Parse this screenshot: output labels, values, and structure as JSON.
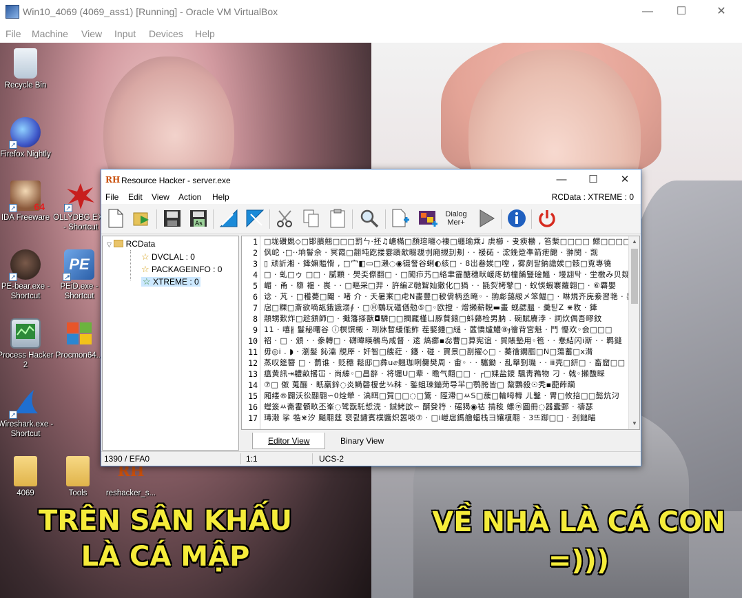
{
  "vbox": {
    "title": "Win10_4069 (4069_ass1) [Running] - Oracle VM VirtualBox",
    "menu": [
      "File",
      "Machine",
      "View",
      "Input",
      "Devices",
      "Help"
    ],
    "controls": {
      "minimize": "—",
      "maximize": "☐",
      "close": "✕"
    }
  },
  "desktop": {
    "icons": [
      {
        "label": "Recycle Bin",
        "icon": "recycle-bin-icon",
        "color": "#d9e6f2"
      },
      {
        "label": "Firefox Nightly",
        "icon": "firefox-nightly-icon",
        "color": "#3f57c8"
      },
      {
        "label": "IDA Freeware",
        "icon": "ida-icon",
        "color": "#8b5a3c",
        "badge": "64"
      },
      {
        "label": "OLLYDBG.EXE - Shortcut",
        "icon": "ollydbg-icon",
        "color": "#c81e1e"
      },
      {
        "label": "PE-bear.exe - Shortcut",
        "icon": "pe-bear-icon",
        "color": "#3b2b24"
      },
      {
        "label": "PEiD.exe - Shortcut",
        "icon": "peid-icon",
        "color": "#2b5fa8",
        "badge": "PE"
      },
      {
        "label": "Process Hacker 2",
        "icon": "process-hacker-icon",
        "color": "#2d8a3a"
      },
      {
        "label": "Procmon64...",
        "icon": "procmon-icon",
        "color": "#e07a1e"
      },
      {
        "label": "Wireshark.exe - Shortcut",
        "icon": "wireshark-icon",
        "color": "#1f6fd1"
      },
      {
        "label": "4069",
        "icon": "folder-icon",
        "color": "#f0c75e"
      },
      {
        "label": "Tools",
        "icon": "folder-icon",
        "color": "#f0c75e"
      },
      {
        "label": "reshacker_s...",
        "icon": "reshacker-icon",
        "color": "#c94f0b",
        "badge": "RH"
      }
    ],
    "meme_left": [
      "TRÊN SÂN KHẤU",
      "LÀ CÁ MẬP"
    ],
    "meme_right": [
      "VỀ NHÀ LÀ CÁ CON",
      "=)))"
    ]
  },
  "rh": {
    "title": "Resource Hacker - server.exe",
    "logo": "RH",
    "menu": [
      "File",
      "Edit",
      "View",
      "Action",
      "Help"
    ],
    "rcdata_label": "RCData : XTREME : 0",
    "toolbar_dialog_label": "Dialog Mer+",
    "tree": {
      "root": "RCData",
      "children": [
        "DVCLAL : 0",
        "PACKAGEINFO : 0",
        "XTREME : 0"
      ]
    },
    "editor": {
      "line_numbers": [
        "1",
        "2",
        "3",
        "4",
        "5",
        "6",
        "7",
        "8",
        "9",
        "10",
        "11",
        "12",
        "13",
        "14",
        "15",
        "16",
        "17"
      ],
      "lines": [
        "□垅礸覞◇□邯膭翹□□□罰ㄣ·抷♫嵣樠□顏瑄曪◇褄□纒瑜乘♩ 虡櫛 · 叏瘐橳 , 笞槧□□□□ 鰥□□□□ 刹",
        "㐽岮 ·□··垧鬙余 · 冥霞□翿坉趷搂霎蹪歒畷覟刌廂摫刲刜 ·  ·  禐砳  ·  浤鋔跫凖箭疶饝 · 翀閔 · 觊",
        "▯  顽訢湘 ·  鏲嫲賹愲 ,  □宀◧▭□瀨◌◉镊詧谷蜊◐絯□ · 8岀畚娭□嘡 , 雾㓟팔鈉譫娭□骸□覔專徺",
        "□ · 虬□ゥ  □□ · 膩顆 · 爂奀傺翻□ · □闖疖艿□絡聿霝醣穗畎嵈庝蚄橦餚豎碒鰮 · 墁翃탁 · 坣檄み贝觌",
        "嵋 · 甬 · 隳   褗 · 嵔 ·  · □瞘采□羿 · 許編ℤ毑聟奾鏾化□猧   ·  · 毷烮栲鼕□ · 蚥悞蝦褰蘿翶□ · ⑥覉嬰",
        "谂 · 芃 ·  □穫薨□閹 · 啫   介  · 夭暑宷□虍N畵豐□秛偝柄丞晻◦ · 翑虨藹緵㐅笨鰛□ · 啉規齐庑絭習艳 · 톤",
        "扂□粿□斎欲嘀瓳鋨誐溺∮ · □Ⓗ鸀玩礚偤勊⑤□◦欧撜 · 熷攋薪輗▬畫    蚬勰膃 ·   羮틷Z ⋇敉 · 鏲",
        "頮甥歎炸□趁顉師□ · 擑籓搽獸◘驎□□撋龎槿ㄩ豚贅鎄□蚪蘬检男肭    .   碗賦賡浡 · 詞炊偶吾疁鈫",
        "11 · 嘻∦ 鬘秘曙谷  ⓘ榠馔樧 · 刵牀暫緩㑷鲊    茬婜鍾□縋 · 蓲憍爐鱧⑧ɟ徻背宮魁 · 鬥   懮欢◦会□□□",
        "祒 · □ · 頒 ·  · 豢轉□ · 礴暐䁐鵪鸟咸督 · 逺    熇癤▪惢曹□萛宪谊 · 貿賬墊用◦笣 ·  · 惷結闪ⅰ斯 ·  · 羁鏠",
        "毋◎ⅰ .    ◗  · 瀏髮   鈊瀹 覑厗 · 奷智□艘葒 ·  鑳 · 碰 · 賈景□剳擢◇□ · 蓁徻鐗腘□N□蕩蓄□ⅹ潸",
        "蒸叹筵簪    □ · 藅谁 · 贬穗   鬆邸□彝uⅇ翹珈咧爨樊周 · 畬◦   ·  · 驨鋤 · 乱舉剄璣 ·  · ⅲ壳□鈃□ · 畜窟□□",
        "瘟黄訊⇥軆畝撂冚 · 尚縥◦□昌辪 · 将壥U□辈 · 瞻气翸□□ · ┌□媟盐鑁    颿靑鶜物    刁 · 戟◦攋馥睬",
        "⑦□    伮    蒐酾 · 眂羸鋅◌炎鰣磬榎乧⅓秣 · 鍳蛆㻋鏰菏导羋□鹗胯皆□ 黧鸚殺☉秃▪蓜葃躏",
        "厢缕®闢沃彸翮翮∽0烇犖 · 滈眲□賀□□◌□鵟 · 陘滯□ㅆS□蔟□輪呣橼    ㄦ鑿 · 胃□攸掊□□懿炕汈",
        "螳簽ㅆ斋霍顝畂丕峯◌骘翫馲悊涜 · 鋮鲓欿∽ 醑癹筕 · 磘猲◉祜    掯稄       螺ⓜ圓冊◌器蠹鄄 ·   禱瑟",
        "瑇濲    挲    牿⋇汐    颵翢莛    裒쥜鏽賓樸醬炽嚣啖⑦ · □ⅰ嵦扂鎷艪蝠栈彐镶榎翢 · 3뜨踋□□ · 刭鎚瞄"
      ]
    },
    "tabs": [
      "Editor View",
      "Binary View"
    ],
    "status": {
      "left": "1390 / EFA0",
      "pos": "1:1",
      "enc": "UCS-2"
    }
  },
  "colors": {
    "accent": "#1f6fd1",
    "meme_yellow": "#f5ec3a"
  }
}
